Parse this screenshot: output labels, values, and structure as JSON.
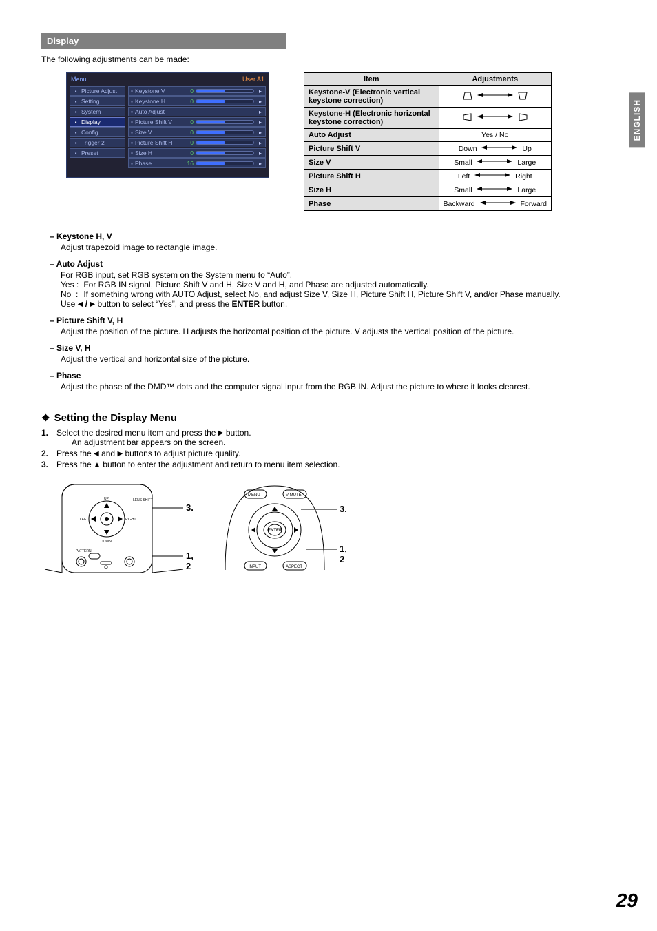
{
  "language_tab": "ENGLISH",
  "page_number": "29",
  "section_title": "Display",
  "intro_text": "The following adjustments can be made:",
  "menu": {
    "title": "Menu",
    "source": "User A1",
    "left_items": [
      {
        "label": "Picture Adjust",
        "active": false
      },
      {
        "label": "Setting",
        "active": false
      },
      {
        "label": "System",
        "active": false
      },
      {
        "label": "Display",
        "active": true
      },
      {
        "label": "Config",
        "active": false
      },
      {
        "label": "Trigger 2",
        "active": false
      },
      {
        "label": "Preset",
        "active": false
      }
    ],
    "right_items": [
      {
        "label": "Keystone V",
        "value": "0",
        "fill": 50,
        "end": true
      },
      {
        "label": "Keystone H",
        "value": "0",
        "fill": 50,
        "end": true
      },
      {
        "label": "Auto Adjust",
        "value": "",
        "fill": 0,
        "end": true,
        "nobar": true
      },
      {
        "label": "Picture Shift V",
        "value": "0",
        "fill": 50,
        "end": true
      },
      {
        "label": "Size V",
        "value": "0",
        "fill": 50,
        "end": true
      },
      {
        "label": "Picture Shift H",
        "value": "0",
        "fill": 50,
        "end": true
      },
      {
        "label": "Size H",
        "value": "0",
        "fill": 50,
        "end": true
      },
      {
        "label": "Phase",
        "value": "16",
        "fill": 50,
        "end": true
      }
    ]
  },
  "adj_table": {
    "header_item": "Item",
    "header_adj": "Adjustments",
    "rows": [
      {
        "item": "Keystone-V (Electronic vertical keystone correction)",
        "left": "",
        "right": "",
        "type": "kv"
      },
      {
        "item": "Keystone-H (Electronic horizontal keystone correction)",
        "left": "",
        "right": "",
        "type": "kh"
      },
      {
        "item": "Auto Adjust",
        "left": "",
        "right": "",
        "type": "text",
        "text": "Yes / No"
      },
      {
        "item": "Picture Shift V",
        "left": "Down",
        "right": "Up",
        "type": "arrow"
      },
      {
        "item": "Size V",
        "left": "Small",
        "right": "Large",
        "type": "arrow"
      },
      {
        "item": "Picture Shift H",
        "left": "Left",
        "right": "Right",
        "type": "arrow"
      },
      {
        "item": "Size H",
        "left": "Small",
        "right": "Large",
        "type": "arrow"
      },
      {
        "item": "Phase",
        "left": "Backward",
        "right": "Forward",
        "type": "arrow"
      }
    ]
  },
  "descriptions": {
    "keystone_hv": {
      "title": "Keystone H, V",
      "body": "Adjust trapezoid image to rectangle image."
    },
    "auto_adjust": {
      "title": "Auto Adjust",
      "line1": "For RGB input, set RGB system on the System menu to “Auto”.",
      "yes": "For RGB IN signal, Picture Shift V and H, Size V and H, and Phase are adjusted automatically.",
      "no": "If something wrong with AUTO Adjust, select No, and adjust Size V, Size H, Picture Shift H, Picture Shift V, and/or Phase manually.",
      "use_a": "Use ",
      "use_b": " button to select “Yes”, and press the ",
      "enter": "ENTER",
      "use_c": " button.",
      "yes_label": "Yes",
      "no_label": "No"
    },
    "picture_shift": {
      "title": "Picture Shift V, H",
      "body": "Adjust the position of the picture. H adjusts the horizontal position of the picture. V adjusts the vertical position of the picture."
    },
    "size_vh": {
      "title": "Size V, H",
      "body": "Adjust the vertical and horizontal size of the picture."
    },
    "phase": {
      "title": "Phase",
      "body": "Adjust the phase of the DMD™ dots and the computer signal input from the RGB IN. Adjust the picture to where it looks clearest."
    }
  },
  "setting_heading": "Setting the Display Menu",
  "steps": [
    {
      "n": "1.",
      "text_a": "Select the desired menu item and press the ",
      "text_b": " button.",
      "sub": "An adjustment bar appears on the screen."
    },
    {
      "n": "2.",
      "text_a": "Press the ",
      "text_mid": " and ",
      "text_b": " buttons to adjust picture quality."
    },
    {
      "n": "3.",
      "text_a": "Press the ",
      "text_b": " button to enter the adjustment and return to menu item selection."
    }
  ],
  "remote": {
    "labels": {
      "lens_shift": "LENS SHIFT",
      "up": "UP",
      "down": "DOWN",
      "left": "LEFT",
      "right": "RIGHT",
      "pattern": "PATTERN"
    },
    "callout1": "3.",
    "callout2": "1, 2"
  },
  "controller": {
    "labels": {
      "menu": "MENU",
      "vmute": "V-MUTE",
      "enter": "ENTER",
      "input": "INPUT",
      "aspect": "ASPECT"
    },
    "callout1": "3.",
    "callout2": "1, 2"
  }
}
